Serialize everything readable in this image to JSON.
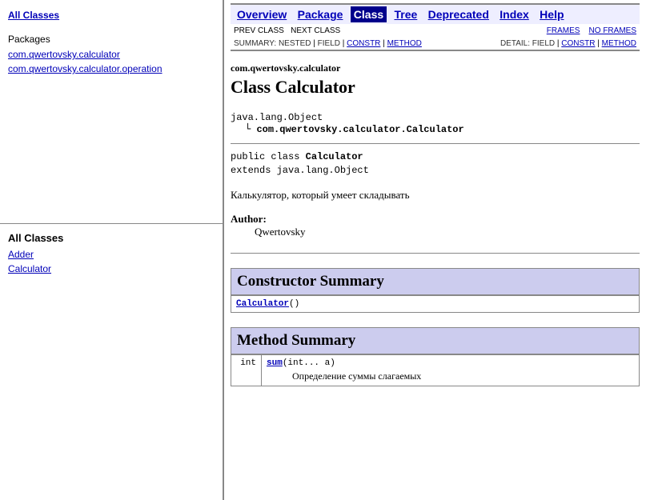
{
  "leftTop": {
    "allClassesLink": "All Classes",
    "packagesLabel": "Packages",
    "packageLinks": [
      "com.qwertovsky.calculator",
      "com.qwertovsky.calculator.operation"
    ]
  },
  "leftBottom": {
    "title": "All Classes",
    "classes": [
      "Adder",
      "Calculator"
    ]
  },
  "nav": {
    "overview": "Overview",
    "package": "Package",
    "class": "Class",
    "tree": "Tree",
    "deprecated": "Deprecated",
    "index": "Index",
    "help": "Help"
  },
  "subNav": {
    "prevClass": "PREV CLASS",
    "nextClass": "NEXT CLASS",
    "frames": "FRAMES",
    "noFrames": "NO FRAMES",
    "summaryLabel": "SUMMARY:",
    "nested": "NESTED",
    "field": "FIELD",
    "constr": "CONSTR",
    "method": "METHOD",
    "detailLabel": "DETAIL:",
    "detailField": "FIELD",
    "detailConstr": "CONSTR",
    "detailMethod": "METHOD"
  },
  "main": {
    "packageName": "com.qwertovsky.calculator",
    "classTitle": "Class Calculator",
    "hierarchy": {
      "parent": "java.lang.Object",
      "child": "com.qwertovsky.calculator.Calculator"
    },
    "signature": {
      "line1pre": "public class ",
      "line1bold": "Calculator",
      "line2": "extends java.lang.Object"
    },
    "description": "Калькулятор, который умеет складывать",
    "authorLabel": "Author:",
    "authorValue": "Qwertovsky",
    "constructorSummary": "Constructor Summary",
    "constructors": [
      {
        "name": "Calculator",
        "params": "()"
      }
    ],
    "methodSummary": "Method Summary",
    "methods": [
      {
        "ret": "int",
        "name": "sum",
        "params": "(int... a)",
        "desc": "Определение суммы слагаемых"
      }
    ]
  }
}
